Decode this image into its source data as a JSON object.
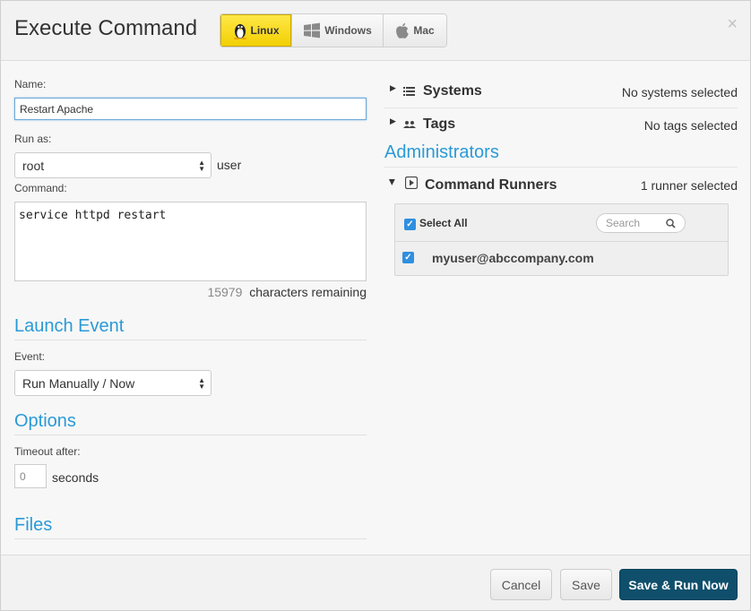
{
  "header": {
    "title": "Execute Command",
    "os_tabs": [
      {
        "label": "Linux",
        "icon": "linux-penguin-icon",
        "active": true
      },
      {
        "label": "Windows",
        "icon": "windows-icon",
        "active": false
      },
      {
        "label": "Mac",
        "icon": "apple-icon",
        "active": false
      }
    ],
    "close_glyph": "×"
  },
  "form": {
    "name_label": "Name:",
    "name_value": "Restart Apache",
    "run_as_label": "Run as:",
    "run_as_value": "root",
    "run_as_suffix": "user",
    "command_label": "Command:",
    "command_value": "service httpd restart",
    "chars_remaining_count": "15979",
    "chars_remaining_text": "characters remaining"
  },
  "launch_event": {
    "heading": "Launch Event",
    "event_label": "Event:",
    "event_value": "Run Manually / Now"
  },
  "options": {
    "heading": "Options",
    "timeout_label": "Timeout after:",
    "timeout_value": "0",
    "timeout_unit": "seconds"
  },
  "files": {
    "heading": "Files"
  },
  "targets": {
    "systems_label": "Systems",
    "systems_status": "No systems selected",
    "tags_label": "Tags",
    "tags_status": "No tags selected"
  },
  "administrators": {
    "heading": "Administrators",
    "runners_label": "Command Runners",
    "runners_status": "1 runner selected",
    "select_all_label": "Select All",
    "search_placeholder": "Search",
    "runners": [
      {
        "email": "myuser@abccompany.com",
        "checked": true
      }
    ]
  },
  "footer": {
    "cancel_label": "Cancel",
    "save_label": "Save",
    "save_run_label": "Save & Run Now"
  },
  "colors": {
    "accent_heading": "#2a9ad6",
    "active_tab": "#f2cf00",
    "primary_button": "#0f4f6b",
    "checkbox": "#2f8fe0"
  }
}
